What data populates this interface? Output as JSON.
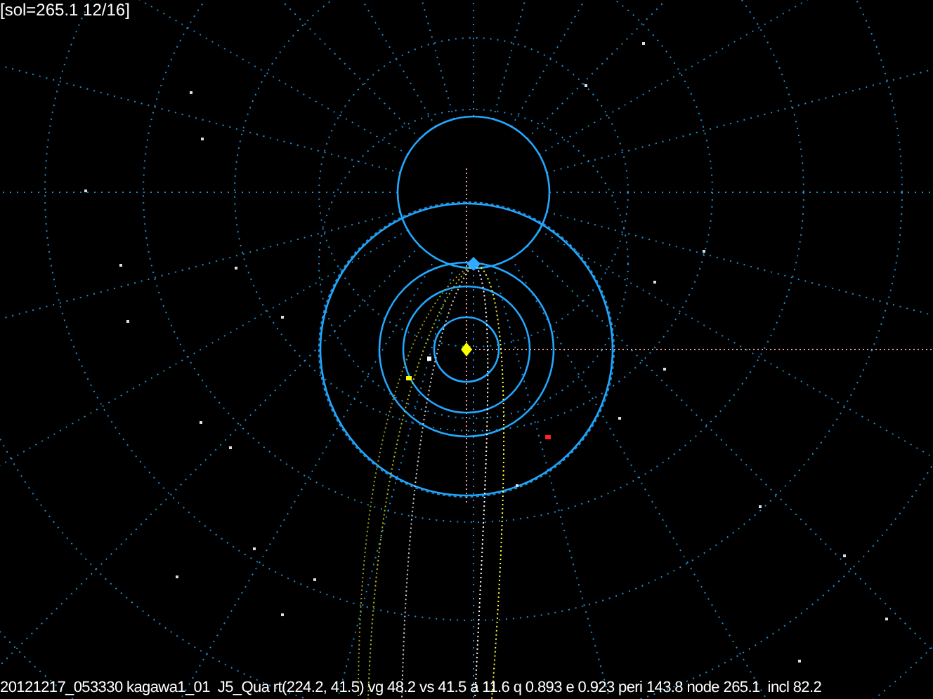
{
  "header": {
    "text": "[sol=265.1 12/16]"
  },
  "footer": {
    "text": "20121217_053330 kagawa1_01  J5_Qua rt(224.2, 41.5) vg 48.2 vs 41.5 a 11.6 q 0.893 e 0.923 peri 143.8 node 265.1  incl 82.2"
  }
}
